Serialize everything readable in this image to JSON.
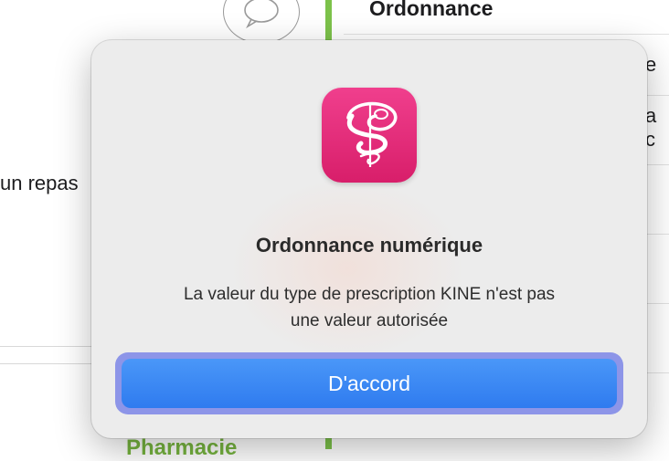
{
  "background": {
    "left_panel": {
      "partial_text": "un repas",
      "partial_link": "Pharmacie"
    },
    "right_panel": {
      "title": "Ordonnance",
      "fragments": [
        "e",
        "a c"
      ]
    },
    "colors": {
      "accent_green": "#7cc24a"
    }
  },
  "dialog": {
    "app_icon": "caduceus-app-icon",
    "title": "Ordonnance numérique",
    "message_line1": "La valeur du type de prescription KINE n'est pas",
    "message_line2": "une valeur autorisée",
    "ok_label": "D'accord",
    "colors": {
      "icon_pink": "#e12a77",
      "button_blue": "#3a86f3",
      "focus_ring": "#8d95e8"
    }
  }
}
